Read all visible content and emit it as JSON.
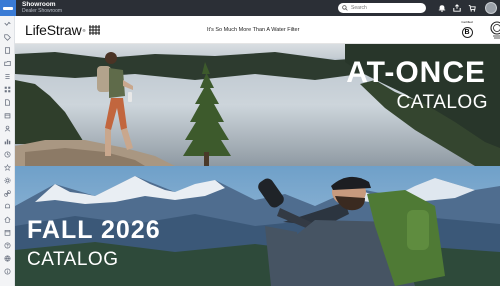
{
  "app": {
    "title": "Showroom",
    "subtitle": "Dealer Showroom"
  },
  "search": {
    "placeholder": "Search"
  },
  "topbar_icons": [
    "notifications-icon",
    "share-icon",
    "cart-icon",
    "user-avatar"
  ],
  "sidebar": {
    "items": [
      "menu-icon",
      "tag-icon",
      "document-icon",
      "folder-icon",
      "list-icon",
      "grid-icon",
      "file-icon",
      "box-icon",
      "people-icon",
      "chart-icon",
      "clock-icon",
      "star-icon",
      "settings-icon",
      "link-icon",
      "bell-icon",
      "home-icon",
      "calendar-icon",
      "help-icon",
      "globe-icon",
      "info-icon"
    ]
  },
  "header": {
    "brand": "LifeStraw",
    "trademark": "®",
    "tagline": "It's So Much More Than A Water Filter",
    "certified_label": "Certified"
  },
  "banners": [
    {
      "title": "AT-ONCE",
      "subtitle": "CATALOG"
    },
    {
      "title": "FALL 2026",
      "subtitle": "CATALOG"
    }
  ],
  "colors": {
    "topbar": "#2b2f36",
    "accent": "#3a7bd5",
    "sidebar": "#f3f4f6"
  }
}
